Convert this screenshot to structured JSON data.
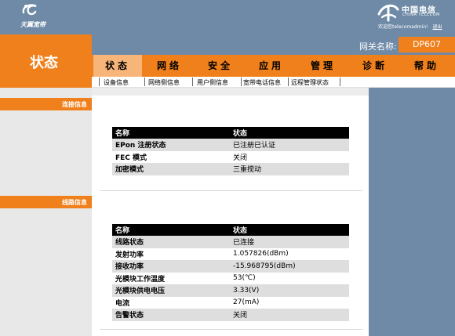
{
  "header": {
    "left_logo_text": "天翼宽带",
    "brand_cn": "中国电信",
    "brand_en": "CHINA TELECOM",
    "welcome_text": "欢迎您telecomadmin!",
    "logout_label": "退出"
  },
  "status_title": "状态",
  "gateway": {
    "label": "网关名称:",
    "value": "DP607"
  },
  "nav": {
    "items": [
      "状态",
      "网络",
      "安全",
      "应用",
      "管理",
      "诊断",
      "帮助"
    ]
  },
  "subnav": {
    "items": [
      "设备信息",
      "网络侧信息",
      "用户侧信息",
      "宽带电话信息",
      "远程管理状态"
    ]
  },
  "sections": {
    "connection": "连接信息",
    "line": "线路信息"
  },
  "connection_table": {
    "headers": [
      "名称",
      "状态"
    ],
    "rows": [
      [
        "EPon 注册状态",
        "已注册已认证"
      ],
      [
        "FEC 模式",
        "关闭"
      ],
      [
        "加密模式",
        "三重搅动"
      ]
    ]
  },
  "line_table": {
    "headers": [
      "名称",
      "状态"
    ],
    "rows": [
      [
        "线路状态",
        "已连接"
      ],
      [
        "发射功率",
        "1.057826(dBm)"
      ],
      [
        "接收功率",
        "-15.968795(dBm)"
      ],
      [
        "光模块工作温度",
        "53(℃)"
      ],
      [
        "光模块供电电压",
        "3.33(V)"
      ],
      [
        "电流",
        "27(mA)"
      ],
      [
        "告警状态",
        "关闭"
      ]
    ]
  },
  "colors": {
    "header_blue": "#6e8aa6",
    "accent_orange": "#f0801c",
    "active_tab": "#f7b57a"
  }
}
